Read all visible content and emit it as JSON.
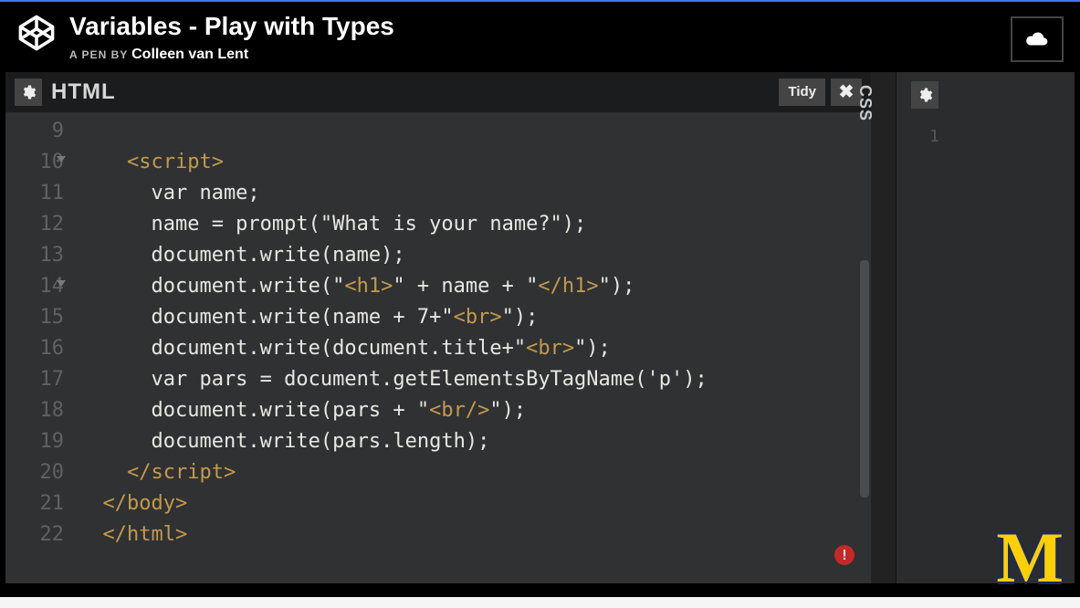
{
  "header": {
    "title": "Variables - Play with Types",
    "byline_label": "A PEN BY",
    "author": "Colleen van Lent"
  },
  "panels": {
    "html": {
      "label": "HTML",
      "tidy_label": "Tidy",
      "close_glyph": "✖",
      "error_glyph": "!",
      "lines": [
        {
          "n": 9,
          "fold": false,
          "tokens": []
        },
        {
          "n": 10,
          "fold": true,
          "tokens": [
            {
              "t": "plain",
              "v": "    "
            },
            {
              "t": "tag",
              "v": "<script>"
            }
          ]
        },
        {
          "n": 11,
          "fold": false,
          "tokens": [
            {
              "t": "plain",
              "v": "      var name;"
            }
          ]
        },
        {
          "n": 12,
          "fold": false,
          "tokens": [
            {
              "t": "plain",
              "v": "      name = prompt(\"What is your name?\");"
            }
          ]
        },
        {
          "n": 13,
          "fold": false,
          "tokens": [
            {
              "t": "plain",
              "v": "      document.write(name);"
            }
          ]
        },
        {
          "n": 14,
          "fold": true,
          "tokens": [
            {
              "t": "plain",
              "v": "      document.write(\""
            },
            {
              "t": "tag",
              "v": "<h1>"
            },
            {
              "t": "plain",
              "v": "\" + name + \""
            },
            {
              "t": "tag",
              "v": "</h1>"
            },
            {
              "t": "plain",
              "v": "\");"
            }
          ]
        },
        {
          "n": 15,
          "fold": false,
          "tokens": [
            {
              "t": "plain",
              "v": "      document.write(name + 7+\""
            },
            {
              "t": "tag",
              "v": "<br>"
            },
            {
              "t": "plain",
              "v": "\");"
            }
          ]
        },
        {
          "n": 16,
          "fold": false,
          "tokens": [
            {
              "t": "plain",
              "v": "      document.write(document.title+\""
            },
            {
              "t": "tag",
              "v": "<br>"
            },
            {
              "t": "plain",
              "v": "\");"
            }
          ]
        },
        {
          "n": 17,
          "fold": false,
          "tokens": [
            {
              "t": "plain",
              "v": "      var pars = document.getElementsByTagName('p');"
            }
          ]
        },
        {
          "n": 18,
          "fold": false,
          "tokens": [
            {
              "t": "plain",
              "v": "      document.write(pars + \""
            },
            {
              "t": "tag",
              "v": "<br/>"
            },
            {
              "t": "plain",
              "v": "\");"
            }
          ]
        },
        {
          "n": 19,
          "fold": false,
          "tokens": [
            {
              "t": "plain",
              "v": "      document.write(pars.length);"
            }
          ]
        },
        {
          "n": 20,
          "fold": false,
          "tokens": [
            {
              "t": "plain",
              "v": "    "
            },
            {
              "t": "tag",
              "v": "</script>"
            }
          ]
        },
        {
          "n": 21,
          "fold": false,
          "tokens": [
            {
              "t": "plain",
              "v": "  "
            },
            {
              "t": "tag",
              "v": "</body>"
            }
          ]
        },
        {
          "n": 22,
          "fold": false,
          "tokens": [
            {
              "t": "plain",
              "v": "  "
            },
            {
              "t": "tag",
              "v": "</html>"
            }
          ]
        }
      ]
    },
    "css": {
      "label": "CSS",
      "first_line_number": "1"
    }
  },
  "watermark": "M"
}
